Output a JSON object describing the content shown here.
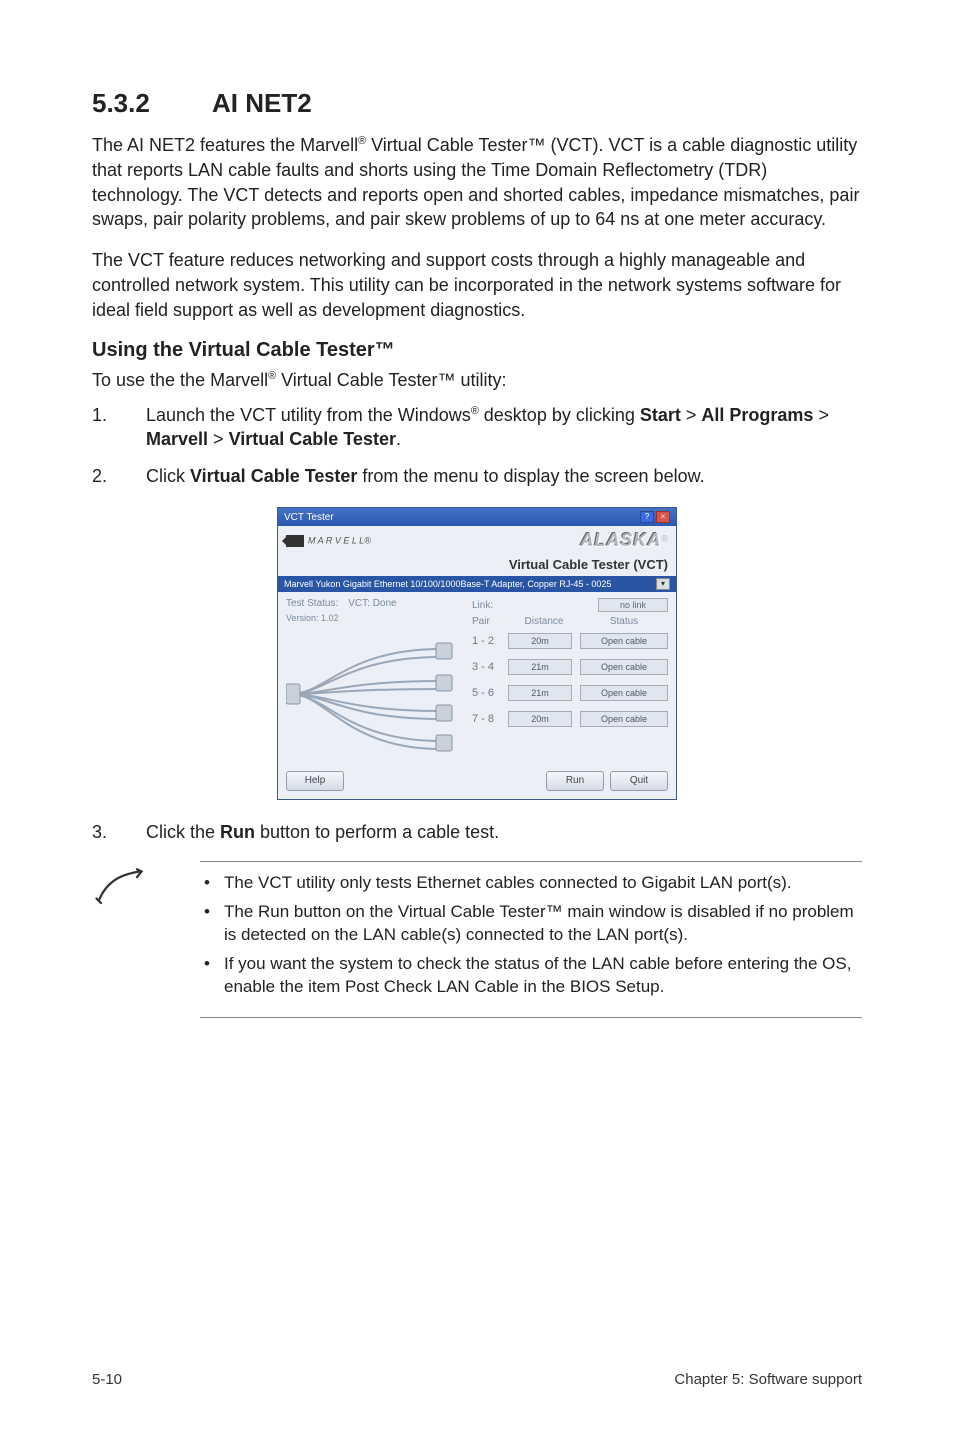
{
  "heading": {
    "num": "5.3.2",
    "title": "AI NET2"
  },
  "para1_parts": {
    "a": "The AI NET2 features the Marvell",
    "b": " Virtual Cable Tester™ (VCT). VCT is a cable diagnostic utility that reports LAN cable faults and shorts using the Time Domain Reflectometry (TDR) technology. The VCT detects and reports open and shorted cables, impedance mismatches, pair swaps, pair polarity problems, and pair skew problems of up to 64 ns at one meter accuracy."
  },
  "para2": "The VCT feature reduces networking and support costs through a highly manageable and controlled network system. This utility can be incorporated in the network systems software for ideal field support as well as development diagnostics.",
  "subhead": "Using the Virtual Cable Tester™",
  "para3_parts": {
    "a": "To use the the Marvell",
    "b": " Virtual Cable Tester™  utility:"
  },
  "steps": {
    "s1": {
      "a": "Launch the VCT utility from the Windows",
      "b": " desktop by clicking ",
      "start": "Start",
      "gt1": " > ",
      "all": "All Programs",
      "gt2": " > ",
      "marv": "Marvell",
      "gt3": " > ",
      "vct": "Virtual Cable Tester",
      "dot": "."
    },
    "s2": {
      "a": "Click ",
      "b": "Virtual Cable Tester",
      "c": " from the menu to display the screen below."
    },
    "s3": {
      "a": "Click the ",
      "b": "Run",
      "c": " button to perform a cable test."
    }
  },
  "vct": {
    "titlebar": "VCT Tester",
    "marvell": "M A R V E L L®",
    "alaska": "ALASKA",
    "reg": "®",
    "subtitle": "Virtual Cable Tester (VCT)",
    "adapter": "Marvell Yukon Gigabit Ethernet 10/100/1000Base-T Adapter, Copper RJ-45 - 0025",
    "test_status_label": "Test Status:",
    "test_status_value": "VCT: Done",
    "version": "Version: 1.02",
    "link_label": "Link:",
    "link_value": "no link",
    "col_pair": "Pair",
    "col_distance": "Distance",
    "col_status": "Status",
    "rows": [
      {
        "pair": "1 - 2",
        "dist": "20m",
        "stat": "Open cable"
      },
      {
        "pair": "3 - 4",
        "dist": "21m",
        "stat": "Open cable"
      },
      {
        "pair": "5 - 6",
        "dist": "21m",
        "stat": "Open cable"
      },
      {
        "pair": "7 - 8",
        "dist": "20m",
        "stat": "Open cable"
      }
    ],
    "btn_help": "Help",
    "btn_run": "Run",
    "btn_quit": "Quit"
  },
  "notes": {
    "n1": "The VCT utility only tests Ethernet cables connected to Gigabit LAN port(s).",
    "n2": "The Run button on the Virtual Cable Tester™ main window is disabled if no problem is detected on the LAN cable(s) connected to the LAN port(s).",
    "n3": "If you want the system to check the status of the LAN cable before entering the OS, enable the item Post Check LAN Cable in the BIOS Setup."
  },
  "footer": {
    "left": "5-10",
    "right": "Chapter 5: Software support"
  },
  "sup": "®"
}
